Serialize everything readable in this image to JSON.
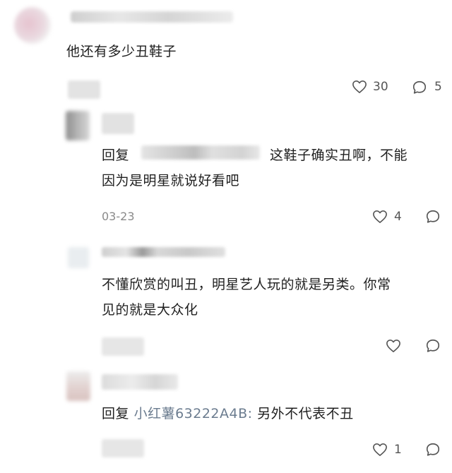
{
  "comments": [
    {
      "text": "他还有多少丑鞋子",
      "likes": "30",
      "replies": "5"
    },
    {
      "reply_prefix": "回复",
      "text_line1": "这鞋子确实丑啊，不能",
      "text_line2": "因为是明星就说好看吧",
      "date": "03-23",
      "likes": "4"
    },
    {
      "text_line1": "不懂欣赏的叫丑，明星艺人玩的就是另类。你常",
      "text_line2": "见的就是大众化"
    },
    {
      "reply_prefix": "回复",
      "mention": "小红薯63222A4B:",
      "text": "另外不代表不丑",
      "likes": "1"
    }
  ],
  "icons": {
    "like": "heart-outline-icon",
    "reply": "speech-bubble-icon"
  },
  "colors": {
    "mention": "#6b7c8f",
    "icon_stroke": "#555555",
    "blur_gray": "#d8d8d8",
    "avatar_pink": "#e8c9d1"
  }
}
